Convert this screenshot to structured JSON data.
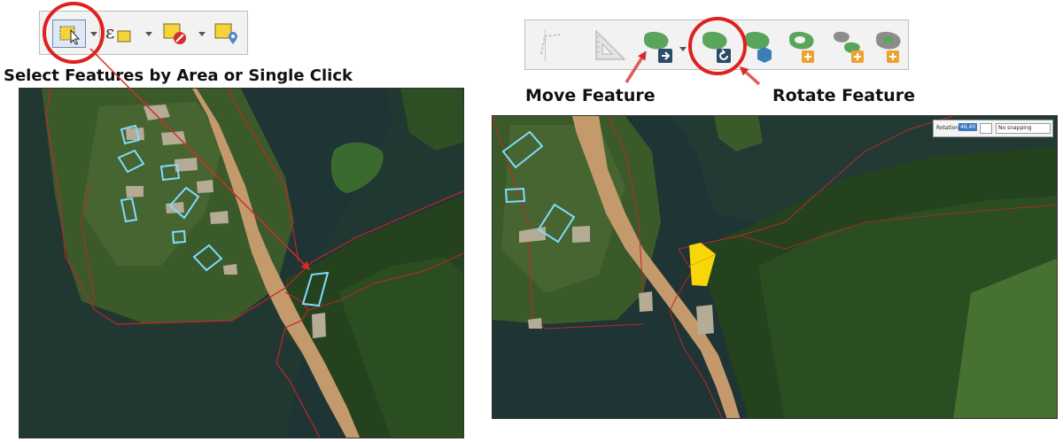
{
  "captions": {
    "select_features": "Select Features by Area or Single Click",
    "move_feature": "Move Feature",
    "rotate_feature": "Rotate Feature"
  },
  "rotation_panel": {
    "label": "Rotation",
    "value": "46.40",
    "snapping": "No snapping"
  },
  "colors": {
    "highlight_circle": "#e0201e",
    "arrow": "#d62b2b",
    "selection_outline": "#7fdcff",
    "selected_feature_fill": "#f7d70a",
    "boundary_line": "#c0252b",
    "tool_yellow": "#f5d33c",
    "tool_green": "#5aa55c",
    "tool_blue": "#3c7fb8",
    "tool_orange": "#f0a030",
    "water": "#1f3434",
    "forest": "#24421e",
    "road": "#c49a6c"
  },
  "icons": [
    "select-features-icon",
    "select-by-expression-icon",
    "deselect-features-icon",
    "select-by-location-icon",
    "vertex-tool-icon",
    "measure-icon",
    "move-feature-icon",
    "rotate-feature-icon",
    "simplify-feature-icon",
    "add-ring-icon",
    "add-part-icon",
    "fill-ring-icon"
  ]
}
